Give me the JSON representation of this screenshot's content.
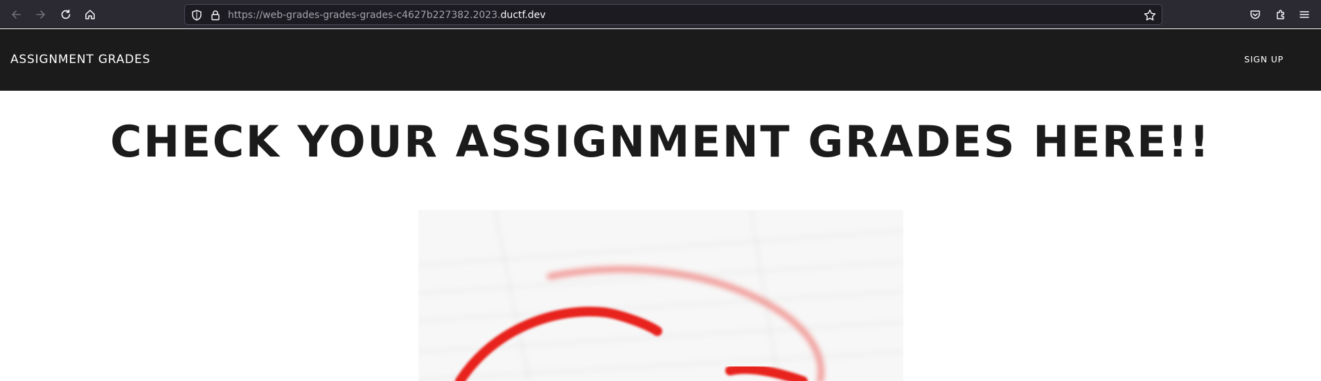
{
  "browser": {
    "url_prefix": "https://web-grades-grades-grades-c4627b227382.2023.",
    "url_host": "ductf.dev",
    "icons": [
      "back-icon",
      "forward-icon",
      "reload-icon",
      "home-icon",
      "shield-icon",
      "lock-icon",
      "bookmark-star-icon",
      "pocket-icon",
      "extensions-icon",
      "menu-icon"
    ]
  },
  "header": {
    "brand": "ASSIGNMENT GRADES",
    "signup_label": "SIGN UP"
  },
  "main": {
    "title": "CHECK YOUR ASSIGNMENT GRADES HERE!!"
  },
  "colors": {
    "chrome_bg": "#2b2a33",
    "urlbar_bg": "#1c1b22",
    "header_bg": "#1b1b1b",
    "title_text": "#1b1b1b",
    "ink_red": "#e8231f"
  }
}
